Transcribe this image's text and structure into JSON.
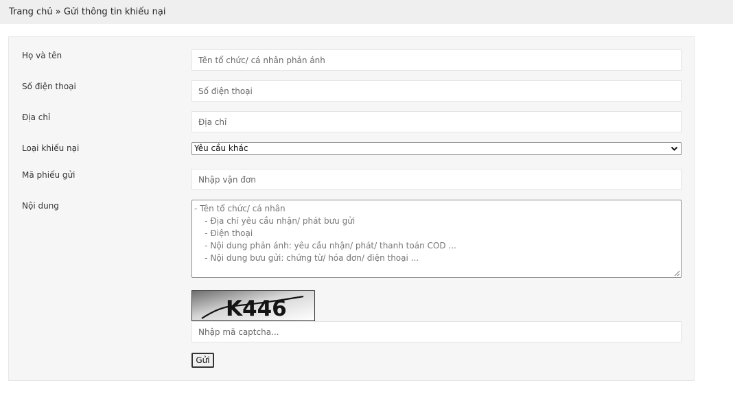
{
  "breadcrumb": {
    "home": "Trang chủ",
    "separator": "»",
    "current": "Gửi thông tin khiếu nại"
  },
  "form": {
    "full_name": {
      "label": "Họ và tên",
      "placeholder": "Tên tổ chức/ cá nhân phản ánh",
      "value": ""
    },
    "phone": {
      "label": "Số điện thoại",
      "placeholder": "Số điện thoại",
      "value": ""
    },
    "address": {
      "label": "Địa chỉ",
      "placeholder": "Địa chỉ",
      "value": ""
    },
    "complaint_type": {
      "label": "Loại khiếu nại",
      "selected": "Yêu cầu khác"
    },
    "tracking_code": {
      "label": "Mã phiếu gửi",
      "placeholder": "Nhập vận đơn",
      "value": ""
    },
    "content": {
      "label": "Nội dung",
      "placeholder": "- Tên tổ chức/ cá nhân\n    - Địa chỉ yêu cầu nhận/ phát bưu gửi\n    - Điện thoại\n    - Nội dung phản ánh: yêu cầu nhận/ phát/ thanh toán COD ...\n    - Nội dung bưu gửi: chứng từ/ hóa đơn/ điện thoại ..."
    },
    "captcha": {
      "image_text": "K446",
      "placeholder": "Nhập mã captcha...",
      "value": ""
    },
    "submit_label": "Gửi"
  },
  "colors": {
    "breadcrumb_background": "#efefef",
    "panel_background": "#f6f6f6",
    "input_border": "#e4e4e4",
    "text": "#333333"
  },
  "icons": {
    "select_arrow": "chevron-down-icon",
    "textarea_resize": "resize-grip-icon"
  }
}
